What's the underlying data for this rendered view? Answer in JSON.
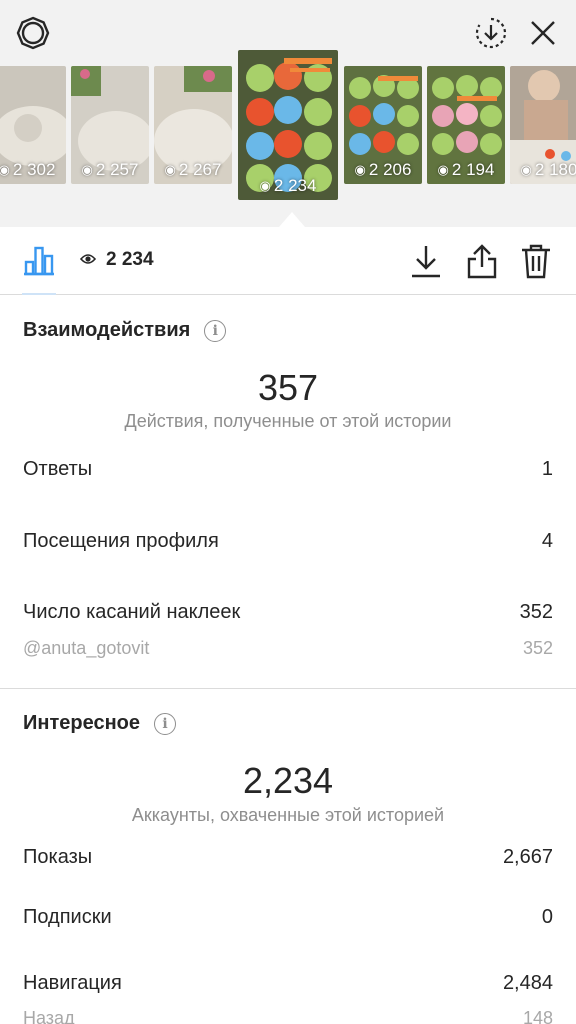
{
  "topbar": {
    "icons": [
      "gear-icon",
      "download-circle-icon",
      "close-icon"
    ]
  },
  "stories": [
    {
      "views": "2 302",
      "bg": "#cfcac0"
    },
    {
      "views": "2 257",
      "bg": "#d6d2ca"
    },
    {
      "views": "2 267",
      "bg": "#d9d3c8"
    },
    {
      "views": "2 234",
      "bg": "#6b7a4a",
      "selected": true
    },
    {
      "views": "2 206",
      "bg": "#7d9a55"
    },
    {
      "views": "2 194",
      "bg": "#86a15c"
    },
    {
      "views": "2 180",
      "bg": "#b7a89b"
    }
  ],
  "toolbar": {
    "views": "2 234",
    "icons": [
      "bar-chart-icon",
      "eye-icon",
      "download-icon",
      "share-icon",
      "trash-icon"
    ],
    "accent": "#3897f0"
  },
  "interactions": {
    "title": "Взаимодействия",
    "total": "357",
    "caption": "Действия, полученные от этой истории",
    "rows": [
      {
        "label": "Ответы",
        "value": "1"
      },
      {
        "label": "Посещения профиля",
        "value": "4"
      },
      {
        "label": "Число касаний наклеек",
        "value": "352"
      },
      {
        "label": "@anuta_gotovit",
        "value": "352"
      }
    ]
  },
  "discovery": {
    "title": "Интересное",
    "total": "2,234",
    "caption": "Аккаунты, охваченные этой историей",
    "rows": [
      {
        "label": "Показы",
        "value": "2,667"
      },
      {
        "label": "Подписки",
        "value": "0"
      },
      {
        "label": "Навигация",
        "value": "2,484"
      },
      {
        "label": "Назад",
        "value": "148"
      }
    ]
  }
}
